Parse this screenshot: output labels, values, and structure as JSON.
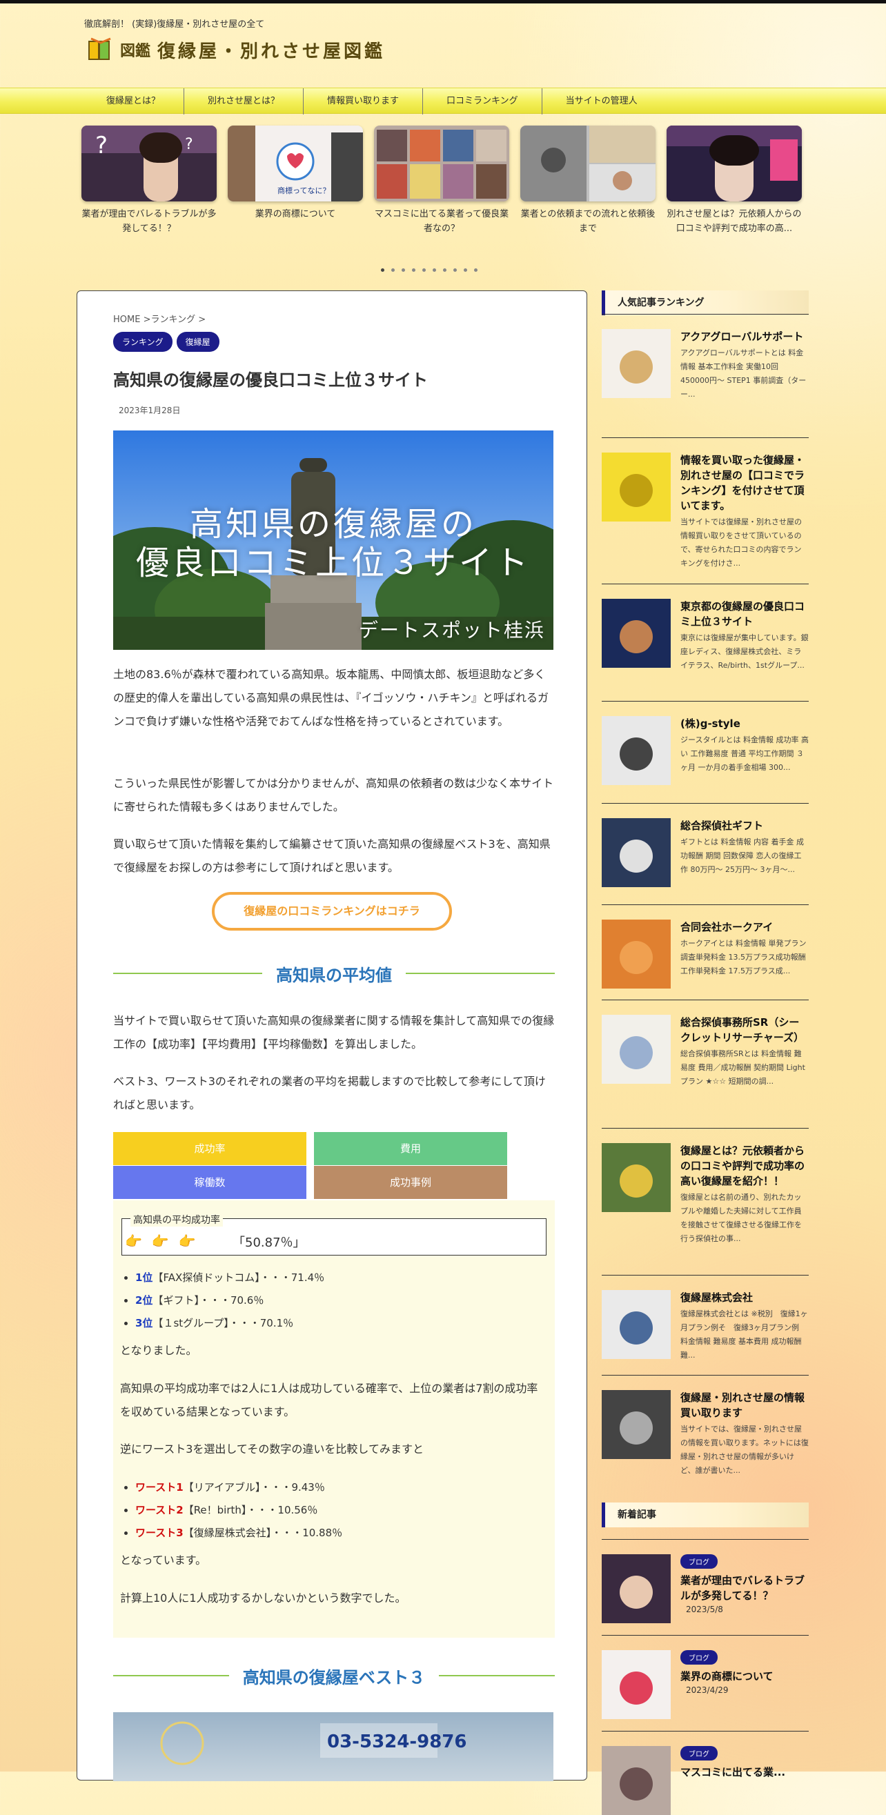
{
  "site": {
    "tagline": "徹底解剖！ (実録)復縁屋・別れさせ屋の全て",
    "logo_zukan": "図鑑",
    "logo_title": "復縁屋・別れさせ屋図鑑"
  },
  "nav": [
    "復縁屋とは？",
    "別れさせ屋とは？",
    "情報買い取ります",
    "口コミランキング",
    "当サイトの管理人"
  ],
  "carousel": [
    {
      "caption": "業者が理由でバレるトラブルが多発してる！？"
    },
    {
      "caption": "業界の商標について"
    },
    {
      "caption": "マスコミに出てる業者って優良業者なの？"
    },
    {
      "caption": "業者との依頼までの流れと依頼後まで"
    },
    {
      "caption": "別れさせ屋とは？元依頼人からの口コミや評判で成功率の高..."
    }
  ],
  "carousel_thumb_text": {
    "shoh": "商標ってなに？"
  },
  "article": {
    "breadcrumb": "HOME >ランキング >",
    "tags": [
      "ランキング",
      "復縁屋"
    ],
    "title": "高知県の復縁屋の優良口コミ上位３サイト",
    "date": "2023年1月28日",
    "hero_line1": "高知県の復縁屋の",
    "hero_line2": "優良口コミ上位３サイト",
    "hero_credit": "デートスポット桂浜",
    "intro": [
      "土地の83.6％が森林で覆われている高知県。坂本龍馬、中岡慎太郎、板垣退助など多くの歴史的偉人を輩出している高知県の県民性は、『イゴッソウ・ハチキン』と呼ばれるガンコで負けず嫌いな性格や活発でおてんばな性格を持っているとされています。",
      "こういった県民性が影響してかは分かりませんが、高知県の依頼者の数は少なく本サイトに寄せられた情報も多くはありませんでした。",
      "買い取らせて頂いた情報を集約して編纂させて頂いた高知県の復縁屋ベスト3を、高知県で復縁屋をお探しの方は参考にして頂ければと思います。"
    ],
    "cta": "復縁屋の口コミランキングはコチラ",
    "h2_avg": "高知県の平均値",
    "avg_paras": [
      "当サイトで買い取らせて頂いた高知県の復縁業者に関する情報を集計して高知県での復縁工作の【成功率】【平均費用】【平均稼働数】を算出しました。",
      "ベスト3、ワースト3のそれぞれの業者の平均を掲載しますので比較して参考にして頂ければと思います。"
    ],
    "tabs": [
      {
        "label": "成功率",
        "color": "#f7cf1f"
      },
      {
        "label": "費用",
        "color": "#66c987"
      },
      {
        "label": "稼働数",
        "color": "#6677ee"
      },
      {
        "label": "成功事例",
        "color": "#bb8c66"
      }
    ],
    "panel": {
      "legend": "高知県の平均成功率",
      "hands": "👉👉👉",
      "value": "「50.87％」",
      "best": [
        {
          "rank": "1位",
          "text": "【FAX探偵ドットコム】・・・71.4％"
        },
        {
          "rank": "2位",
          "text": "【ギフト】・・・70.6％"
        },
        {
          "rank": "3位",
          "text": "【１stグループ】・・・70.1％"
        }
      ],
      "p1": "となりました。",
      "p2": "高知県の平均成功率では2人に1人は成功している確率で、上位の業者は7割の成功率を収めている結果となっています。",
      "p3": "逆にワースト3を選出してその数字の違いを比較してみますと",
      "worst": [
        {
          "rank": "ワースト1",
          "text": "【リアイアブル】・・・9.43％"
        },
        {
          "rank": "ワースト2",
          "text": "【Re！birth】・・・10.56％"
        },
        {
          "rank": "ワースト3",
          "text": "【復縁屋株式会社】・・・10.88％"
        }
      ],
      "p4": "となっています。",
      "p5": "計算上10人に1人成功するかしないかという数字でした。"
    },
    "h2_best": "高知県の復縁屋ベスト３",
    "bottom_phone": "03-5324-9876"
  },
  "sidebar": {
    "popular_heading": "人気記事ランキング",
    "popular": [
      {
        "title": "アクアグローバルサポート",
        "excerpt": "アクアグローバルサポートとは 料金情報 基本工作料金 実働10回 450000円～ STEP1 事前調査（ターー..."
      },
      {
        "title": "情報を買い取った復縁屋・別れさせ屋の【口コミでランキング】を付けさせて頂いてます。",
        "excerpt": "当サイトでは復縁屋・別れさせ屋の情報買い取りをさせて頂いているので、寄せられた口コミの内容でランキングを付けさ..."
      },
      {
        "title": "東京都の復縁屋の優良口コミ上位３サイト",
        "excerpt": "東京には復縁屋が集中しています。銀座レディス、復縁屋株式会社、ミライテラス、Re/birth、1stグループ..."
      },
      {
        "title": "(株)g-style",
        "excerpt": "ジースタイルとは 料金情報 成功率 高い 工作難易度 普通 平均工作期間 ３ヶ月 一か月の着手金相場 300..."
      },
      {
        "title": "総合探偵社ギフト",
        "excerpt": "ギフトとは 料金情報 内容 着手金 成功報酬 期間 回数保障 恋人の復縁工作 80万円～ 25万円～ 3ヶ月～..."
      },
      {
        "title": "合同会社ホークアイ",
        "excerpt": "ホークアイとは 料金情報 単発プラン 調査単発料金 13.5万プラス成功報酬 工作単発料金 17.5万プラス成..."
      },
      {
        "title": "総合探偵事務所SR（シークレットリサーチャーズ）",
        "excerpt": "総合探偵事務所SRとは 料金情報 難易度 費用／成功報酬 契約期間 Lightプラン ★☆☆ 短期間の調..."
      },
      {
        "title": "復縁屋とは？元依頼者からの口コミや評判で成功率の高い復縁屋を紹介！！",
        "excerpt": "復縁屋とは名前の通り、別れたカップルや離婚した夫婦に対して工作員を接触させて復縁させる復縁工作を行う探偵社の事..."
      },
      {
        "title": "復縁屋株式会社",
        "excerpt": "復縁屋株式会社とは ※税別　復縁1ヶ月プラン例そ　復縁3ヶ月プラン例 料金情報 難易度 基本費用 成功報酬 難..."
      },
      {
        "title": "復縁屋・別れさせ屋の情報買い取ります",
        "excerpt": "当サイトでは、復縁屋・別れさせ屋の情報を買い取ります。ネットには復縁屋・別れさせ屋の情報が多いけど、誰が書いた..."
      }
    ],
    "new_heading": "新着記事",
    "new_posts": [
      {
        "tag": "ブログ",
        "title": "業者が理由でバレるトラブルが多発してる！？",
        "date": "2023/5/8"
      },
      {
        "tag": "ブログ",
        "title": "業界の商標について",
        "date": "2023/4/29"
      },
      {
        "tag": "ブログ",
        "title": "マスコミに出てる業..."
      }
    ]
  }
}
